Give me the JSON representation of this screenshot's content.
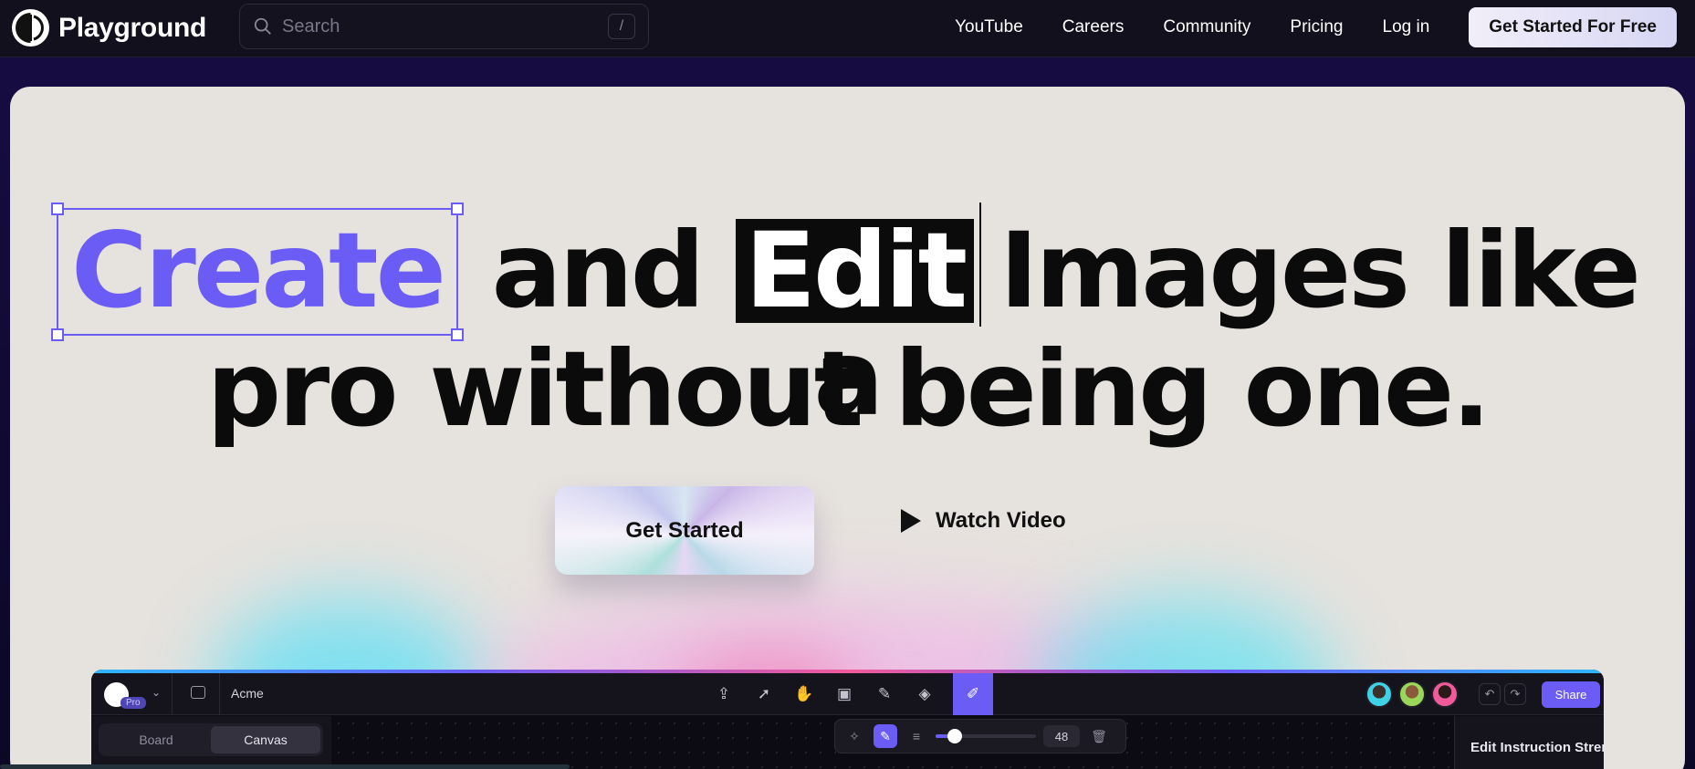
{
  "brand": {
    "name": "Playground"
  },
  "search": {
    "placeholder": "Search",
    "shortcut": "/"
  },
  "nav": {
    "items": [
      "YouTube",
      "Careers",
      "Community",
      "Pricing",
      "Log in"
    ],
    "cta": "Get Started For Free"
  },
  "hero": {
    "line1": {
      "create": "Create",
      "and": "and",
      "edit": "Edit",
      "rest": "Images like a"
    },
    "line2": "pro without being one.",
    "primary_button": "Get Started",
    "secondary_button": "Watch Video"
  },
  "app": {
    "workspace": "Acme",
    "plan_badge": "Pro",
    "share": "Share",
    "tabs": [
      "Board",
      "Canvas"
    ],
    "active_tab": "Canvas",
    "brush_size": "48",
    "panel_title": "Edit Instruction Strength",
    "tools": [
      "upload-icon",
      "select-arrow-icon",
      "hand-icon",
      "image-add-icon",
      "pen-icon",
      "eraser-icon",
      "edit-brush-icon"
    ]
  },
  "colors": {
    "accent": "#6a5cf5",
    "hero_bg": "#e6e2de",
    "topbar_bg": "#12101d"
  }
}
